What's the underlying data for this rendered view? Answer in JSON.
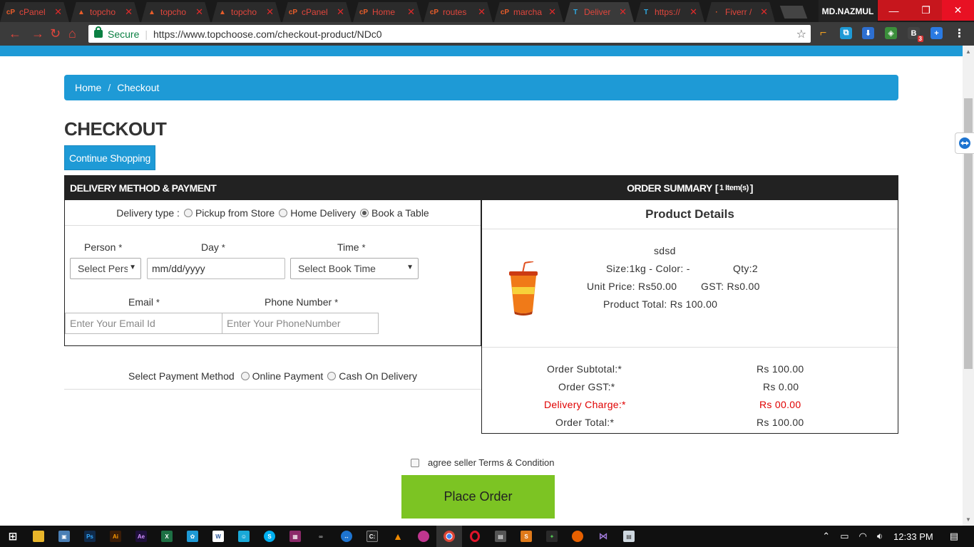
{
  "browser": {
    "tabs": [
      {
        "label": "cPanel",
        "icon": "cpanel-icon",
        "active": false
      },
      {
        "label": "topcho",
        "icon": "topchoose-icon",
        "active": false
      },
      {
        "label": "topcho",
        "icon": "topchoose-icon",
        "active": false
      },
      {
        "label": "topcho",
        "icon": "topchoose-icon",
        "active": false
      },
      {
        "label": "cPanel",
        "icon": "cpanel-icon",
        "active": false
      },
      {
        "label": "Home",
        "icon": "cpanel-icon",
        "active": false
      },
      {
        "label": "routes",
        "icon": "cpanel-icon",
        "active": false
      },
      {
        "label": "marcha",
        "icon": "cpanel-icon",
        "active": false
      },
      {
        "label": "Deliver",
        "icon": "tc-icon",
        "active": true
      },
      {
        "label": "https://",
        "icon": "tc-icon",
        "active": false
      },
      {
        "label": "Fiverr /",
        "icon": "fiverr-icon",
        "active": false
      }
    ],
    "user": "MD.NAZMUL",
    "secure_label": "Secure",
    "url": "https://www.topchoose.com/checkout-product/NDc0",
    "extension_badge": "3"
  },
  "breadcrumb": {
    "home": "Home",
    "separator": "/",
    "current": "Checkout"
  },
  "page": {
    "title": "CHECKOUT",
    "continue_label": "Continue Shopping"
  },
  "delivery": {
    "header": "DELIVERY METHOD & PAYMENT",
    "type_label": "Delivery type :",
    "options": [
      "Pickup from Store",
      "Home Delivery",
      "Book a Table"
    ],
    "selected": "Book a Table",
    "person_label": "Person",
    "day_label": "Day",
    "time_label": "Time",
    "email_label": "Email",
    "phone_label": "Phone Number",
    "required_mark": "*",
    "person_select": "Select Person",
    "day_placeholder": "mm/dd/yyyy",
    "time_select": "Select Book Time",
    "email_placeholder": "Enter Your Email Id",
    "phone_placeholder": "Enter Your PhoneNumber"
  },
  "payment": {
    "label": "Select Payment Method",
    "options": [
      "Online Payment",
      "Cash On Delivery"
    ]
  },
  "summary": {
    "header": "ORDER SUMMARY",
    "item_count": "1 Item(s)",
    "bracket_open": "[",
    "bracket_close": "]",
    "product_details": "Product Details",
    "product": {
      "name": "sdsd",
      "size_color": "Size:1kg - Color: -",
      "qty": "Qty:2",
      "unit_price": "Unit Price: Rs50.00",
      "gst": "GST: Rs0.00",
      "product_total": "Product Total: Rs 100.00"
    },
    "rows": [
      {
        "label": "Order Subtotal:*",
        "value": "Rs 100.00",
        "highlight": false
      },
      {
        "label": "Order GST:*",
        "value": "Rs 0.00",
        "highlight": false
      },
      {
        "label": "Delivery Charge:*",
        "value": "Rs 00.00",
        "highlight": true
      },
      {
        "label": "Order Total:*",
        "value": "Rs 100.00",
        "highlight": false
      }
    ]
  },
  "terms_label": "agree seller Terms & Condition",
  "place_order_label": "Place Order",
  "taskbar": {
    "time": "12:33 PM"
  },
  "colors": {
    "accent": "#1e9ad6",
    "header_dark": "#222222",
    "place_order": "#7cc423",
    "delivery_charge": "#e00000"
  }
}
